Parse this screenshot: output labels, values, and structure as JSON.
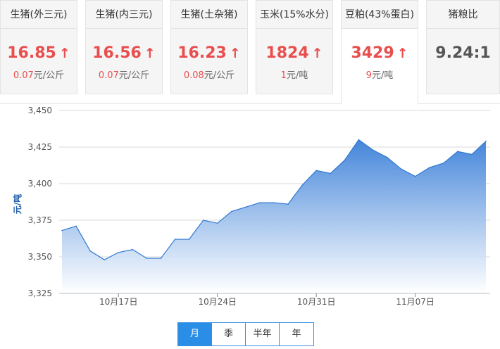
{
  "cards": [
    {
      "title": "生猪(外三元)",
      "price": "16.85",
      "change_num": "0.07",
      "change_unit": "元/公斤"
    },
    {
      "title": "生猪(内三元)",
      "price": "16.56",
      "change_num": "0.07",
      "change_unit": "元/公斤"
    },
    {
      "title": "生猪(土杂猪)",
      "price": "16.23",
      "change_num": "0.08",
      "change_unit": "元/公斤"
    },
    {
      "title": "玉米(15%水分)",
      "price": "1824",
      "change_num": "1",
      "change_unit": "元/吨"
    },
    {
      "title": "豆粕(43%蛋白)",
      "price": "3429",
      "change_num": "9",
      "change_unit": "元/吨"
    },
    {
      "title": "猪粮比",
      "ratio": "9.24:1"
    }
  ],
  "arrow_glyph": "↑",
  "colors": {
    "up": "#e94e4e",
    "accent": "#2b8ee6",
    "area_top": "#3a7fd8",
    "area_bottom": "#ffffff"
  },
  "period_buttons": [
    "月",
    "季",
    "半年",
    "年"
  ],
  "period_selected": 0,
  "chart_data": {
    "type": "area",
    "ylabel": "元/吨",
    "ylim": [
      3325,
      3450
    ],
    "yticks": [
      "3,325",
      "3,350",
      "3,375",
      "3,400",
      "3,425",
      "3,450"
    ],
    "xticks": [
      "10月17日",
      "10月24日",
      "10月31日",
      "11月07日"
    ],
    "dates": [
      "10-13",
      "10-14",
      "10-15",
      "10-16",
      "10-17",
      "10-18",
      "10-19",
      "10-20",
      "10-21",
      "10-22",
      "10-23",
      "10-24",
      "10-25",
      "10-26",
      "10-27",
      "10-28",
      "10-29",
      "10-30",
      "10-31",
      "11-01",
      "11-02",
      "11-03",
      "11-04",
      "11-05",
      "11-06",
      "11-07",
      "11-08",
      "11-09",
      "11-10",
      "11-11",
      "11-12"
    ],
    "values": [
      3368,
      3371,
      3354,
      3348,
      3353,
      3355,
      3349,
      3349,
      3362,
      3362,
      3375,
      3373,
      3381,
      3384,
      3387,
      3387,
      3386,
      3399,
      3409,
      3407,
      3416,
      3430,
      3423,
      3418,
      3410,
      3405,
      3411,
      3414,
      3422,
      3420,
      3429
    ],
    "grid": true,
    "legend": "none"
  }
}
